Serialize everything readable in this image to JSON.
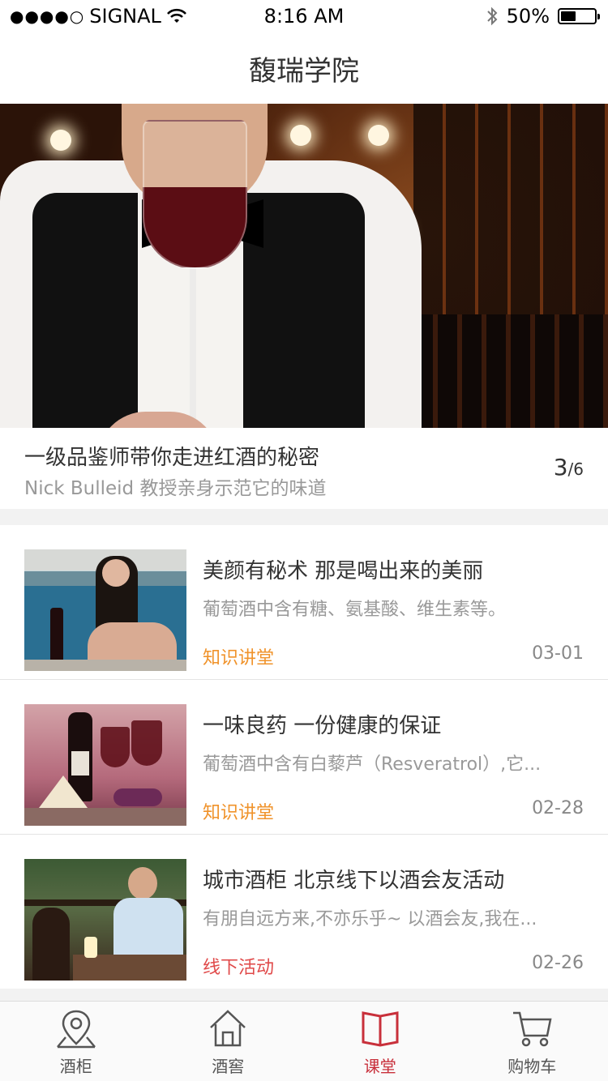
{
  "status_bar": {
    "carrier": "SIGNAL",
    "time": "8:16 AM",
    "battery": "50%",
    "battery_level": 0.5
  },
  "nav": {
    "title": "馥瑞学院"
  },
  "hero": {
    "title": "一级品鉴师带你走进红酒的秘密",
    "subtitle": "Nick Bulleid 教授亲身示范它的味道",
    "page_current": "3",
    "page_total": "/6"
  },
  "articles": [
    {
      "title": "美颜有秘术   那是喝出来的美丽",
      "desc": "葡萄酒中含有糖、氨基酸、维生素等。",
      "tag": "知识讲堂",
      "tag_color": "#f0932b",
      "date": "03-01"
    },
    {
      "title": "一味良药   一份健康的保证",
      "desc": "葡萄酒中含有白藜芦（Resveratrol）,它...",
      "tag": "知识讲堂",
      "tag_color": "#f0932b",
      "date": "02-28"
    },
    {
      "title": "城市酒柜 北京线下以酒会友活动",
      "desc": "有朋自远方来,不亦乐乎~  以酒会友,我在...",
      "tag": "线下活动",
      "tag_color": "#e04a4a",
      "date": "02-26"
    }
  ],
  "tabs": [
    {
      "label": "酒柜",
      "icon": "location-pin-icon",
      "active": false
    },
    {
      "label": "酒窖",
      "icon": "house-icon",
      "active": false
    },
    {
      "label": "课堂",
      "icon": "book-icon",
      "active": true
    },
    {
      "label": "购物车",
      "icon": "cart-icon",
      "active": false
    }
  ],
  "colors": {
    "accent": "#c8303b",
    "tag_orange": "#f0932b",
    "tag_red": "#e04a4a"
  }
}
